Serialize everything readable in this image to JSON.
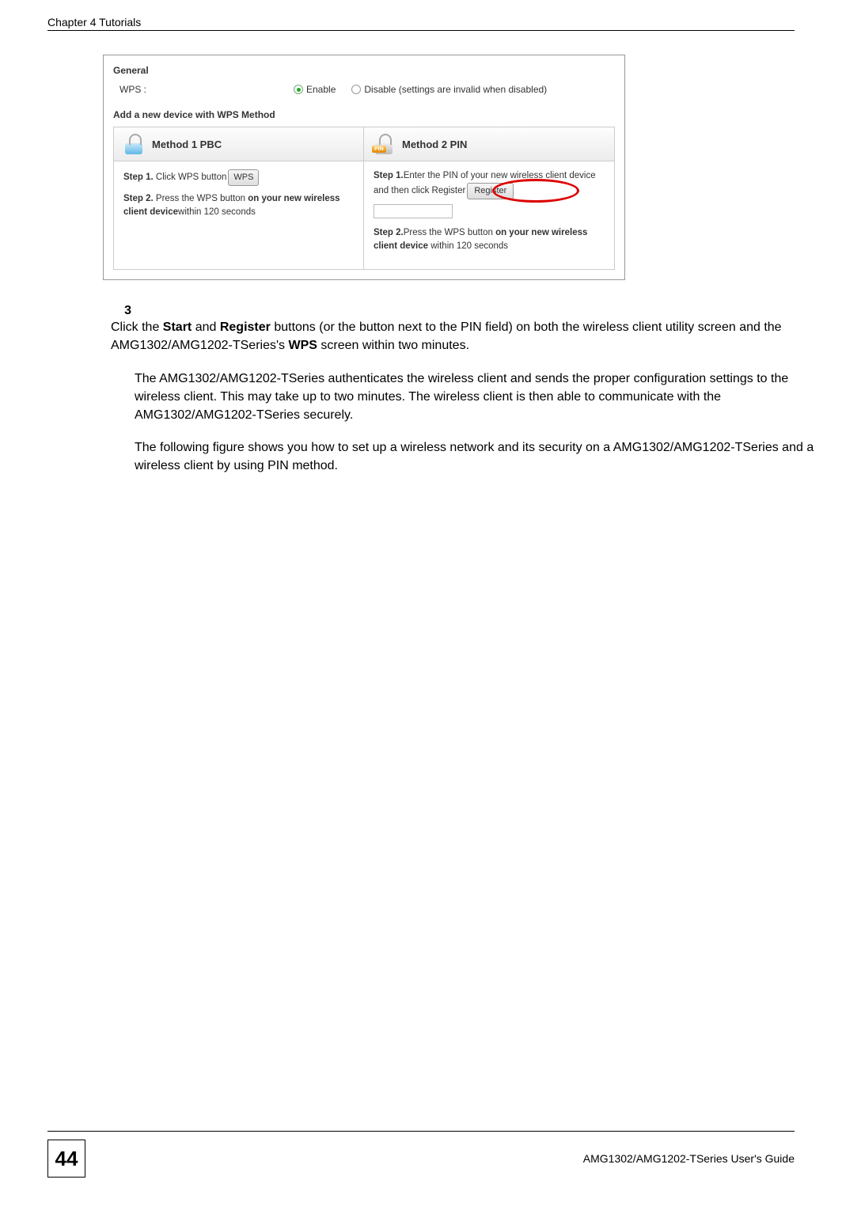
{
  "header": {
    "chapter": "Chapter 4 Tutorials"
  },
  "screenshot": {
    "general_label": "General",
    "wps_label": "WPS :",
    "enable_label": "Enable",
    "disable_label": "Disable (settings are invalid when disabled)",
    "add_device_label": "Add a new device with WPS Method",
    "method1": {
      "title": "Method 1 PBC",
      "step1_prefix": "Step 1.",
      "step1_text": " Click WPS button",
      "wps_button": "WPS",
      "step2_prefix": "Step 2.",
      "step2_text_a": " Press the WPS button ",
      "step2_bold": "on your new wireless client device",
      "step2_text_b": "within 120 seconds"
    },
    "method2": {
      "title": "Method 2 PIN",
      "pin_badge": "PIN",
      "step1_prefix": "Step 1.",
      "step1_text": "Enter the PIN of your new wireless client device and then click Register",
      "register_button": "Register",
      "step2_prefix": "Step 2.",
      "step2_text_a": "Press the WPS button ",
      "step2_bold": "on your new wireless client device",
      "step2_text_b": " within 120 seconds"
    }
  },
  "step3": {
    "num": "3",
    "text_a": "Click the ",
    "b1": "Start",
    "text_b": " and ",
    "b2": "Register",
    "text_c": " buttons (or the button next to the PIN field) on both the wireless client utility screen and the AMG1302/AMG1202-TSeries's ",
    "b3": "WPS",
    "text_d": " screen within two minutes."
  },
  "para2": "The AMG1302/AMG1202-TSeries authenticates the wireless client and sends the proper configuration settings to the wireless client. This may take up to two minutes. The wireless client is then able to communicate with the AMG1302/AMG1202-TSeries securely.",
  "para3": "The following figure shows you how to set up a wireless network and its security on a AMG1302/AMG1202-TSeries and a wireless client by using PIN method.",
  "footer": {
    "page": "44",
    "guide": "AMG1302/AMG1202-TSeries User's Guide"
  }
}
